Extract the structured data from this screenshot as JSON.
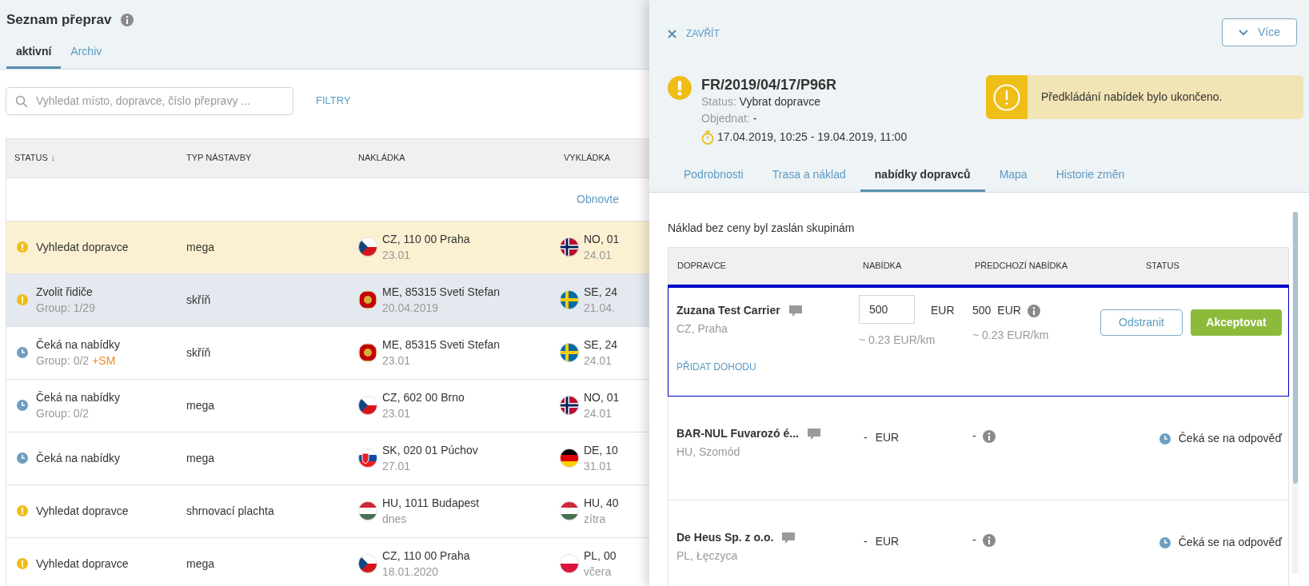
{
  "list": {
    "title": "Seznam přeprav",
    "tabs": [
      {
        "label": "aktivní",
        "selected": true
      },
      {
        "label": "Archiv",
        "selected": false
      }
    ],
    "search": {
      "placeholder": "Vyhledat místo, dopravce, číslo přepravy ..."
    },
    "filter_link": "FILTRY",
    "columns": [
      "STATUS",
      "TYP NÁSTAVBY",
      "NAKLÁDKA",
      "VYKLÁDKA"
    ],
    "sort_arrow": "↓",
    "refresh_link": "Obnovte",
    "rows": [
      {
        "highlighted": true,
        "selected": false,
        "status": {
          "kind": "warning",
          "text": "Vyhledat dopravce"
        },
        "body_type": "mega",
        "loading": {
          "kind": "cz",
          "place": "CZ, 110 00 Praha",
          "date": "23.01"
        },
        "unloading": {
          "kind": "no",
          "place": "NO, 01",
          "date": "24.01"
        }
      },
      {
        "highlighted": false,
        "selected": true,
        "status": {
          "kind": "warning",
          "text": "Zvolit řidiče",
          "group": "Group: 1/29"
        },
        "body_type": "skříň",
        "loading": {
          "kind": "me",
          "place": "ME, 85315 Sveti Stefan",
          "date": "20.04.2019"
        },
        "unloading": {
          "kind": "se",
          "place": "SE, 24",
          "date": "21.04."
        }
      },
      {
        "highlighted": false,
        "selected": false,
        "status": {
          "kind": "waiting",
          "text": "Čeká na nabídky",
          "group": "Group: 0/2",
          "group_extra": "+SM"
        },
        "body_type": "skříň",
        "loading": {
          "kind": "me",
          "place": "ME, 85315 Sveti Stefan",
          "date": "23.01"
        },
        "unloading": {
          "kind": "se",
          "place": "SE, 24",
          "date": "24.01"
        }
      },
      {
        "highlighted": false,
        "selected": false,
        "status": {
          "kind": "waiting",
          "text": "Čeká na nabídky",
          "group": "Group: 0/2"
        },
        "body_type": "mega",
        "loading": {
          "kind": "cz",
          "place": "CZ, 602 00 Brno",
          "date": "23.01"
        },
        "unloading": {
          "kind": "no",
          "place": "NO, 01",
          "date": "24.01"
        }
      },
      {
        "highlighted": false,
        "selected": false,
        "status": {
          "kind": "waiting",
          "text": "Čeká na nabídky"
        },
        "body_type": "mega",
        "loading": {
          "kind": "sk",
          "place": "SK, 020 01 Púchov",
          "date": "27.01"
        },
        "unloading": {
          "kind": "de",
          "place": "DE, 10",
          "date": "31.01"
        }
      },
      {
        "highlighted": false,
        "selected": false,
        "status": {
          "kind": "warning",
          "text": "Vyhledat dopravce"
        },
        "body_type": "shrnovací plachta",
        "loading": {
          "kind": "hu",
          "place": "HU, 1011 Budapest",
          "date": "dnes"
        },
        "unloading": {
          "kind": "hu",
          "place": "HU, 40",
          "date": "zítra"
        }
      },
      {
        "highlighted": false,
        "selected": false,
        "status": {
          "kind": "warning",
          "text": "Vyhledat dopravce"
        },
        "body_type": "mega",
        "loading": {
          "kind": "cz",
          "place": "CZ, 110 00 Praha",
          "date": "18.01.2020"
        },
        "unloading": {
          "kind": "pl",
          "place": "PL, 00",
          "date": "včera"
        }
      }
    ]
  },
  "detail": {
    "close_label": "ZAVŘÍT",
    "more_button": "Více",
    "shipment_id": "FR/2019/04/17/P96R",
    "status_label": "Status:",
    "status_value": "Vybrat dopravce",
    "order_label": "Objednat:",
    "order_value": "-",
    "time_range": "17.04.2019, 10:25 - 19.04.2019, 11:00",
    "alert": "Předkládání nabídek bylo ukončeno.",
    "tabs": [
      {
        "label": "Podrobnosti",
        "selected": false
      },
      {
        "label": "Trasa a náklad",
        "selected": false
      },
      {
        "label": "nabídky dopravců",
        "selected": true
      },
      {
        "label": "Mapa",
        "selected": false
      },
      {
        "label": "Historie změn",
        "selected": false
      }
    ],
    "note": "Náklad bez ceny byl zaslán skupinám",
    "columns": [
      "DOPRAVCE",
      "NABÍDKA",
      "PŘEDCHOZÍ NABÍDKA",
      "STATUS"
    ],
    "carriers": [
      {
        "selected": true,
        "name": "Zuzana Test Carrier",
        "location": "CZ, Praha",
        "offer": {
          "kind": "input",
          "value": "500",
          "currency": "EUR",
          "per_km": "~ 0.23 EUR/km"
        },
        "previous": {
          "value": "500",
          "currency": "EUR",
          "per_km": "~ 0.23 EUR/km"
        },
        "actions": [
          "Odstranit",
          "Akceptovat"
        ],
        "link": "PŘIDAT DOHODU"
      },
      {
        "selected": false,
        "name": "BAR-NUL Fuvarozó é...",
        "location": "HU, Szomód",
        "offer": {
          "kind": "text",
          "value": "-",
          "currency": "EUR"
        },
        "previous": {
          "value": "-"
        },
        "status": "Čeká se na odpověď"
      },
      {
        "selected": false,
        "name": "De Heus Sp. z o.o.",
        "location": "PL, Łęczyca",
        "offer": {
          "kind": "text",
          "value": "-",
          "currency": "EUR"
        },
        "previous": {
          "value": "-"
        },
        "status": "Čeká se na odpověď"
      }
    ]
  }
}
